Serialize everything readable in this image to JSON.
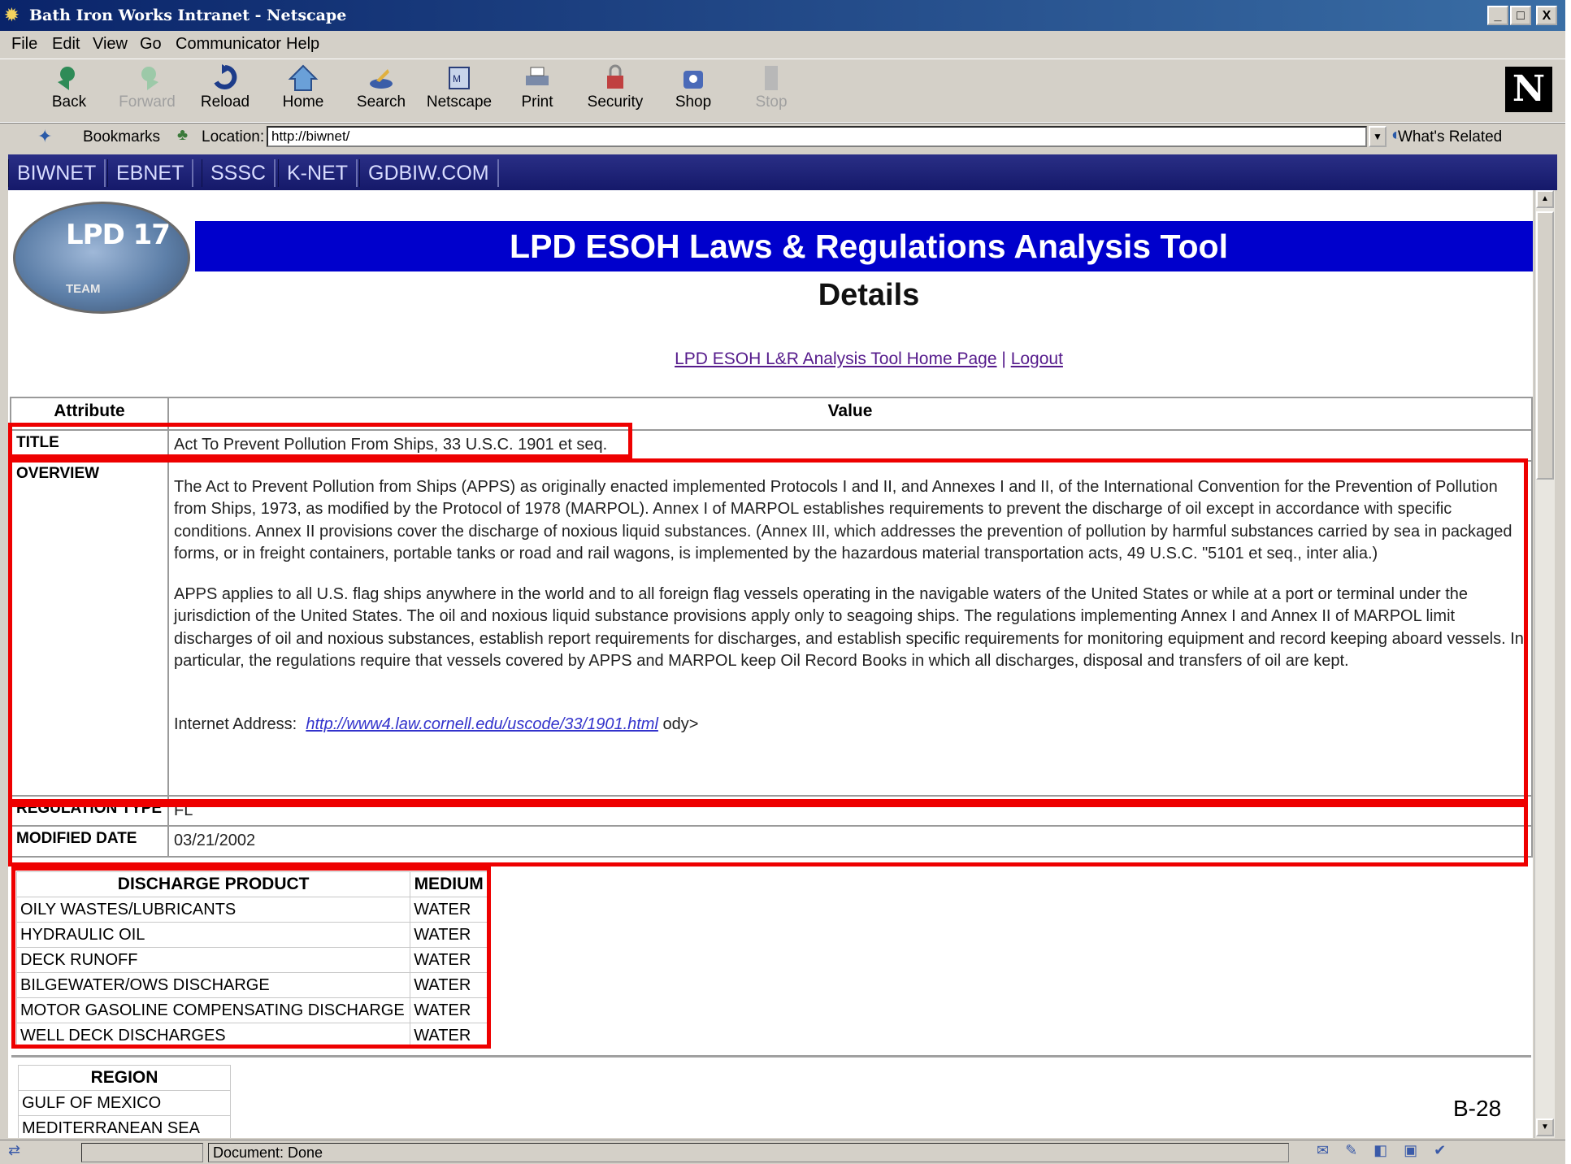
{
  "window": {
    "title": "Bath Iron Works Intranet - Netscape",
    "buttons": [
      "_",
      "□",
      "X"
    ]
  },
  "menu": [
    "File",
    "Edit",
    "View",
    "Go",
    "Communicator",
    "Help"
  ],
  "toolbar": {
    "back": "Back",
    "forward": "Forward",
    "reload": "Reload",
    "home": "Home",
    "search": "Search",
    "netscape": "Netscape",
    "print": "Print",
    "security": "Security",
    "shop": "Shop",
    "stop": "Stop"
  },
  "location_bar": {
    "bookmarks": "Bookmarks",
    "location_label": "Location:",
    "url": "http://biwnet/",
    "related": "What's Related"
  },
  "site_nav": [
    "BIWNET",
    "EBNET",
    "SSSC",
    "K-NET",
    "GDBIW.COM"
  ],
  "page": {
    "logo_text": "LPD 17",
    "logo_sub": "TEAM",
    "banner": "LPD ESOH Laws & Regulations Analysis Tool",
    "subtitle": "Details",
    "link_home": "LPD ESOH L&R Analysis Tool Home Page",
    "link_separator": "|",
    "link_logout": "Logout"
  },
  "details": {
    "header_attribute": "Attribute",
    "header_value": "Value",
    "title_label": "TITLE",
    "title_value": "Act To Prevent Pollution From Ships, 33 U.S.C. 1901 et seq.",
    "overview_label": "OVERVIEW",
    "overview_p1": "The Act to Prevent Pollution from Ships (APPS) as originally enacted implemented Protocols I and II, and Annexes I and II, of the International Convention for the Prevention of Pollution from Ships, 1973, as modified by the Protocol of 1978 (MARPOL). Annex I of MARPOL establishes requirements to prevent the discharge of oil except in accordance with specific conditions. Annex II provisions cover the discharge of noxious liquid substances. (Annex III, which addresses the prevention of pollution by harmful substances carried by sea in packaged forms, or in freight containers, portable tanks or road and rail wagons, is implemented by the hazardous material transportation acts, 49 U.S.C. \"5101 et seq., inter alia.)",
    "overview_p2": "APPS applies to all U.S. flag ships anywhere in the world and to all foreign flag vessels operating in the navigable waters of the United States or while at a port or terminal under the jurisdiction of the United States. The oil and noxious liquid substance provisions apply only to seagoing ships. The regulations implementing Annex I and Annex II of MARPOL limit discharges of oil and noxious substances, establish report requirements for discharges, and establish specific requirements for monitoring equipment and record keeping aboard vessels. In particular, the regulations require that vessels covered by APPS and MARPOL keep Oil Record Books in which all discharges, disposal and transfers of oil are kept.",
    "internet_label": "Internet Address:",
    "internet_link": "http://www4.law.cornell.edu/uscode/33/1901.html",
    "internet_trailing": "ody>",
    "regtype_label": "REGULATION TYPE",
    "regtype_value": "FL",
    "modified_label": "MODIFIED DATE",
    "modified_value": "03/21/2002"
  },
  "discharge": {
    "header_product": "DISCHARGE PRODUCT",
    "header_medium": "MEDIUM",
    "rows": [
      {
        "product": "OILY WASTES/LUBRICANTS",
        "medium": "WATER"
      },
      {
        "product": "HYDRAULIC OIL",
        "medium": "WATER"
      },
      {
        "product": "DECK RUNOFF",
        "medium": "WATER"
      },
      {
        "product": "BILGEWATER/OWS DISCHARGE",
        "medium": "WATER"
      },
      {
        "product": "MOTOR GASOLINE COMPENSATING DISCHARGE",
        "medium": "WATER"
      },
      {
        "product": "WELL DECK DISCHARGES",
        "medium": "WATER"
      }
    ]
  },
  "region": {
    "header": "REGION",
    "rows": [
      "GULF OF MEXICO",
      "MEDITERRANEAN SEA"
    ]
  },
  "page_number": "B-28",
  "status": {
    "text": "Document: Done"
  },
  "colors": {
    "banner": "#0000cc",
    "highlight": "#ee0000",
    "nav": "#1a237e"
  }
}
